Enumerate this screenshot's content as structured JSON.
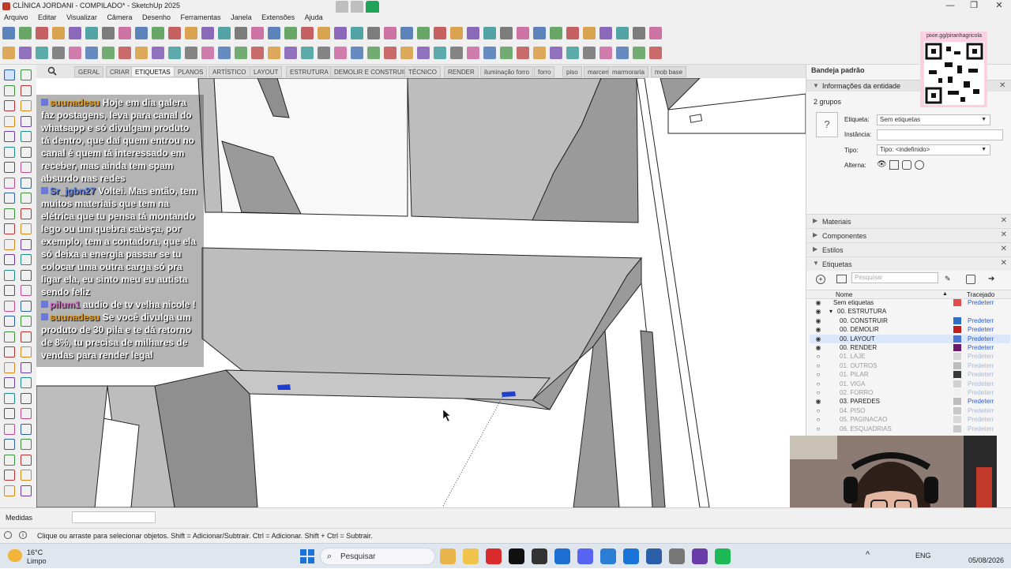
{
  "window": {
    "title": "CLÍNICA JORDANI - COMPILADO* - SketchUp 2025",
    "controls": [
      "—",
      "❐",
      "✕"
    ]
  },
  "menu": [
    "Arquivo",
    "Editar",
    "Visualizar",
    "Câmera",
    "Desenho",
    "Ferramentas",
    "Janela",
    "Extensões",
    "Ajuda"
  ],
  "scene_tabs": [
    {
      "label": "GERAL",
      "active": false
    },
    {
      "label": "CRIAR",
      "active": false
    },
    {
      "label": "ETIQUETAS",
      "active": true
    },
    {
      "label": "PLANOS",
      "active": false
    },
    {
      "label": "ARTÍSTICO",
      "active": false
    },
    {
      "label": "LAYOUT",
      "active": false
    },
    {
      "label": "ESTRUTURA",
      "active": false
    },
    {
      "label": "DEMOLIR E CONSTRUIR",
      "active": false
    },
    {
      "label": "TÉCNICO",
      "active": false
    },
    {
      "label": "RENDER",
      "active": false
    },
    {
      "label": "iluminação forro",
      "active": false
    },
    {
      "label": "forro",
      "active": false
    },
    {
      "label": "piso",
      "active": false
    },
    {
      "label": "marcenaria",
      "active": false
    },
    {
      "label": "marmoraria",
      "active": false
    },
    {
      "label": "mob base",
      "active": false
    }
  ],
  "chat": [
    {
      "user": "suunadesu",
      "user_color": "orange",
      "text": "Hoje em dia galera faz postagens, leva para canal do whatsapp e só divulgam produto tá dentro, que daí quem entrou no canal é quem tá interessado em receber, mas ainda tem spam absurdo nas redes"
    },
    {
      "user": "Sr_jgbn27",
      "user_color": "blue",
      "text": "Voltei. Mas então, tem muitos materiais que tem na elétrica que tu pensa tá montando lego ou um quebra cabeça, por exemplo, tem a contadora, que ela só deixa a energia passar se tu colocar uma outra carga só pra ligar ela, eu sinto meu eu autista sendo feliz"
    },
    {
      "user": "pilum1",
      "user_color": "pink",
      "text": "audio de tv velha nicole !"
    },
    {
      "user": "suunadesu",
      "user_color": "orange",
      "text": "Se você divulga um produto de 30 pila e te dá retorno de 8%, tu precisa de milhares de vendas para render legal"
    }
  ],
  "tray": {
    "title": "Bandeja padrão",
    "entity_info_header": "Informações da entidade",
    "groups_count": "2 grupos",
    "tag_label": "Etiqueta:",
    "tag_value": "Sem etiquetas",
    "instance_label": "Instância:",
    "instance_value": "",
    "type_label": "Tipo:",
    "type_value": "Tipo: <indefinido>",
    "toggles_label": "Alterna:",
    "panels": [
      "Materiais",
      "Componentes",
      "Estilos",
      "Etiquetas"
    ],
    "tags_search_placeholder": "Pesquisar",
    "tags_col_name": "Nome",
    "tags_col_dash": "Tracejado",
    "tags": [
      {
        "name": "Sem etiquetas",
        "indent": 0,
        "visible": true,
        "color": "#e84b4b",
        "dash": "Predeterr"
      },
      {
        "name": "00. ESTRUTURA",
        "indent": 1,
        "visible": true,
        "color": "",
        "dash": "",
        "folder": true
      },
      {
        "name": "00. CONSTRUIR",
        "indent": 2,
        "visible": true,
        "color": "#2f6fbf",
        "dash": "Predeterr"
      },
      {
        "name": "00. DEMOLIR",
        "indent": 2,
        "visible": true,
        "color": "#c21e1e",
        "dash": "Predeterr"
      },
      {
        "name": "00. LAYOUT",
        "indent": 2,
        "visible": true,
        "color": "#4a74d6",
        "dash": "Predeterr",
        "selected": true
      },
      {
        "name": "00. RENDER",
        "indent": 2,
        "visible": true,
        "color": "#6b1a6b",
        "dash": "Predeterr"
      },
      {
        "name": "01. LAJE",
        "indent": 2,
        "visible": false,
        "color": "#d8d8d8",
        "dash": "Predeterr"
      },
      {
        "name": "01. OUTROS",
        "indent": 2,
        "visible": false,
        "color": "#bcbcbc",
        "dash": "Predeterr"
      },
      {
        "name": "01. PILAR",
        "indent": 2,
        "visible": false,
        "color": "#3a3a3a",
        "dash": "Predeterr"
      },
      {
        "name": "01. VIGA",
        "indent": 2,
        "visible": false,
        "color": "#d0d0d0",
        "dash": "Predeterr"
      },
      {
        "name": "02. FORRO",
        "indent": 2,
        "visible": false,
        "color": "#f0f0f0",
        "dash": "Predeterr"
      },
      {
        "name": "03. PAREDES",
        "indent": 2,
        "visible": true,
        "color": "#bdbdbd",
        "dash": "Predeterr"
      },
      {
        "name": "04. PISO",
        "indent": 2,
        "visible": false,
        "color": "#c8c8c8",
        "dash": "Predeterr"
      },
      {
        "name": "05. PAGINACAO",
        "indent": 2,
        "visible": false,
        "color": "#d9d9d9",
        "dash": "Predeterr"
      },
      {
        "name": "06. ESQUADRIAS",
        "indent": 2,
        "visible": false,
        "color": "#c9c9c9",
        "dash": "Predeterr"
      }
    ]
  },
  "qr_caption": "pixie.gg/piranhagricola",
  "measure_label": "Medidas",
  "status_text": "Clique ou arraste para selecionar objetos. Shift = Adicionar/Subtrair. Ctrl = Adicionar. Shift + Ctrl = Subtrair.",
  "taskbar": {
    "weather_temp": "16°C",
    "weather_desc": "Limpo",
    "search_placeholder": "Pesquisar",
    "lang": "ENG",
    "date": "05/08/2026"
  },
  "colors": {
    "accent": "#2f6fbf",
    "selection_blue": "#1f3fd1",
    "wall_gray": "#9e9e9e",
    "wall_light": "#c4c4c4"
  }
}
